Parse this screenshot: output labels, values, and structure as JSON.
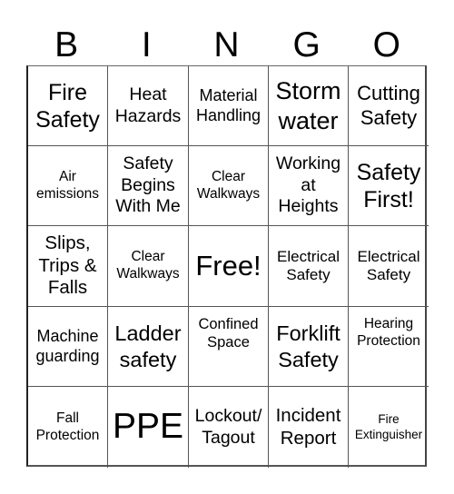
{
  "header": {
    "letters": [
      "B",
      "I",
      "N",
      "G",
      "O"
    ]
  },
  "cells": [
    [
      "Fire\nSafety",
      "Heat\nHazards",
      "Material\nHandling",
      "Storm\nwater",
      "Cutting\nSafety"
    ],
    [
      "Air\nemissions",
      "Safety\nBegins\nWith Me",
      "Clear\nWalkways",
      "Working\nat\nHeights",
      "Safety\nFirst!"
    ],
    [
      "Slips,\nTrips &\nFalls",
      "Clear\nWalkways",
      "Free!",
      "Electrical\nSafety",
      "Electrical\nSafety"
    ],
    [
      "Machine\nguarding",
      "Ladder\nsafety",
      "Confined\nSpace",
      "Forklift\nSafety",
      "Hearing\nProtection"
    ],
    [
      "Fall\nProtection",
      "PPE",
      "Lockout/\nTagout",
      "Incident\nReport",
      "Fire\nExtinguisher"
    ]
  ],
  "free_space": {
    "row": 2,
    "col": 2,
    "label": "Free!"
  }
}
